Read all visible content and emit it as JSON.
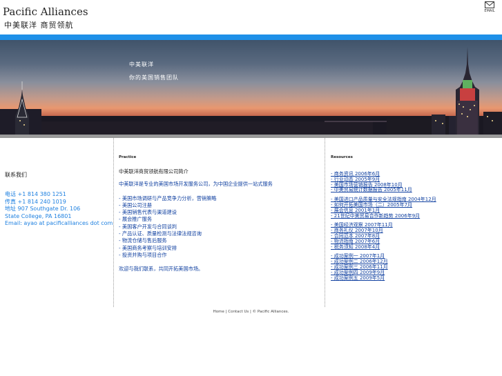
{
  "header": {
    "logo_title": "Pacific Alliances",
    "logo_subtitle": "中美联洋 商贸领航",
    "email_label": "EMAIL"
  },
  "banner": {
    "slogan_line1": "中美联洋",
    "slogan_line2": "你的美国销售团队"
  },
  "contact": {
    "heading": "联系我们",
    "lines": [
      "电话 +1 814 380 1251",
      "传真 +1 814 240 1019",
      "地址 907 Southgate Dr. 106",
      "State College, PA 16801",
      "Email: ayao at pacificalliances dot com"
    ]
  },
  "practice": {
    "label": "Practice",
    "title": "中美联洋商贸领航有限公司简介",
    "intro": "中美联洋是专业的美国市场开发服务公司，为中国企业提供一站式服务",
    "items": [
      "- 美国市场调研与产品竞争力分析，营销策略",
      "- 美国公司注册",
      "- 美国销售代表与渠道建设",
      "- 展会推广服务",
      "- 美国客户开发与合同谈判",
      "- 产品认证、质量检测与法律法规咨询",
      "- 物流仓储与售后服务",
      "- 美国商务考察与培训安排",
      "- 投资并购与项目合作"
    ],
    "closing": "欢迎与我们联系，共同开拓美国市场。"
  },
  "resources": {
    "label": "Resources",
    "groups": [
      [
        "- 商务资讯 2006年6月",
        "- 行业动态 2005年9月",
        "- 美国市场营销报告 2008年10月",
        "- 中美贸易统计数据报告 2005年11月"
      ],
      [
        "- 美国进口产品质量与安全法规指南 2004年12月",
        "- 如何开拓美国市场（二）2005年7月",
        "- 展会信息 2001年1月",
        "- 21世纪中美贸易合作新趋势 2006年9月"
      ],
      [
        "- 美国经济观察 2007年11月",
        "- 商务礼仪 2007年10月",
        "- 合同范本 2007年8月",
        "- 物流指南 2007年6月",
        "- 税务须知 2008年4月"
      ],
      [
        "- 成功案例一 2007年1月",
        "- 成功案例二 2006年12月",
        "- 成功案例三 2006年11月",
        "- 成功案例四 2009年9月",
        "- 成功案例五 2009年5月"
      ]
    ]
  },
  "footer": {
    "home": "Home",
    "sep1": "|",
    "contact": "Contact Us",
    "sep2": "|",
    "copyright": "© Pacific Alliances."
  },
  "colors": {
    "accent_blue": "#1e90e8",
    "link_blue": "#1040a0",
    "contact_blue": "#1e80e0"
  }
}
